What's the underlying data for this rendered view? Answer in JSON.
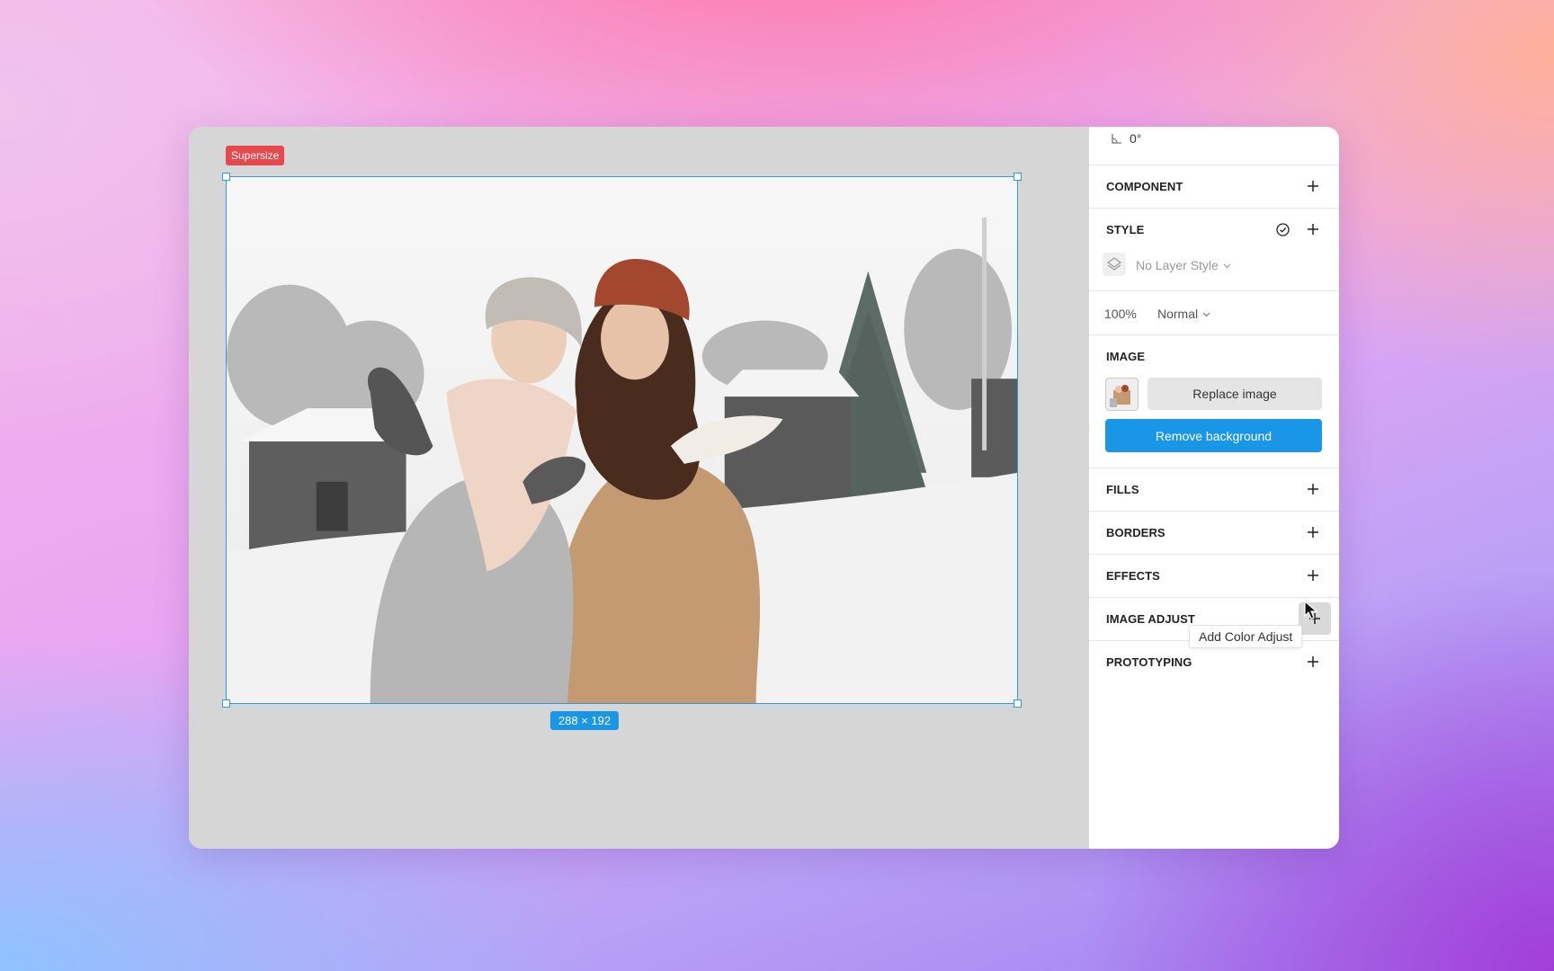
{
  "canvas": {
    "artboard_label": "Supersize",
    "size_badge": "288 × 192",
    "image_alt": "Two women in winter sweaters looking up at falling snow in front of snowy cabins"
  },
  "panel": {
    "rotation": "0°",
    "component": {
      "title": "COMPONENT"
    },
    "style": {
      "title": "STYLE",
      "layer_style": "No Layer Style"
    },
    "opacity": "100%",
    "blend_mode": "Normal",
    "image": {
      "title": "IMAGE",
      "replace_label": "Replace image",
      "remove_bg_label": "Remove background"
    },
    "fills": {
      "title": "FILLS"
    },
    "borders": {
      "title": "BORDERS"
    },
    "effects": {
      "title": "EFFECTS"
    },
    "image_adjust": {
      "title": "IMAGE ADJUST"
    },
    "prototyping": {
      "title": "PROTOTYPING"
    }
  },
  "tooltip": "Add Color Adjust",
  "colors": {
    "accent_blue": "#1a96e6",
    "artboard_label_red": "#e5484d",
    "canvas_gray": "#d6d6d6"
  }
}
